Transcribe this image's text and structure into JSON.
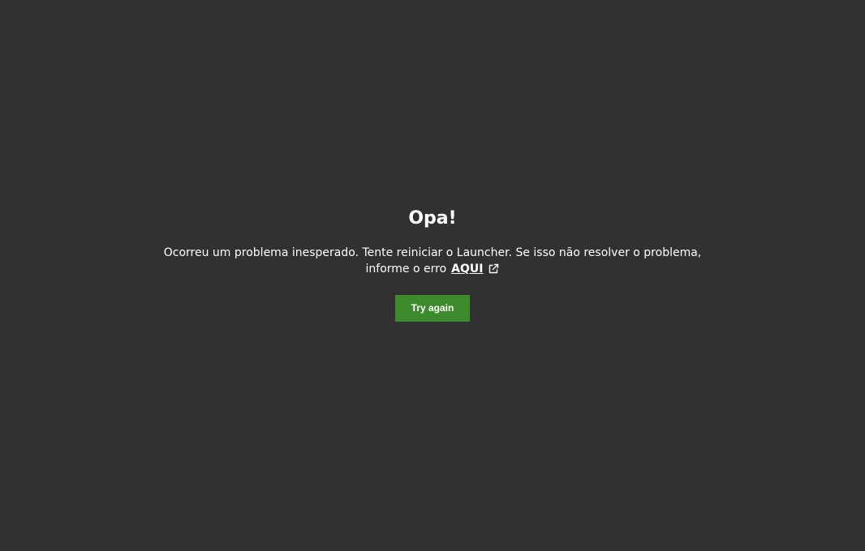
{
  "error": {
    "title": "Opa!",
    "message": "Ocorreu um problema inesperado. Tente reiniciar o Launcher. Se isso não resolver o problema, informe o erro",
    "link_label": "AQUI",
    "link_icon": "external-link-icon",
    "button_label": "Try again"
  },
  "colors": {
    "background": "#313131",
    "text": "#ffffff",
    "button": "#3d8a2c"
  }
}
